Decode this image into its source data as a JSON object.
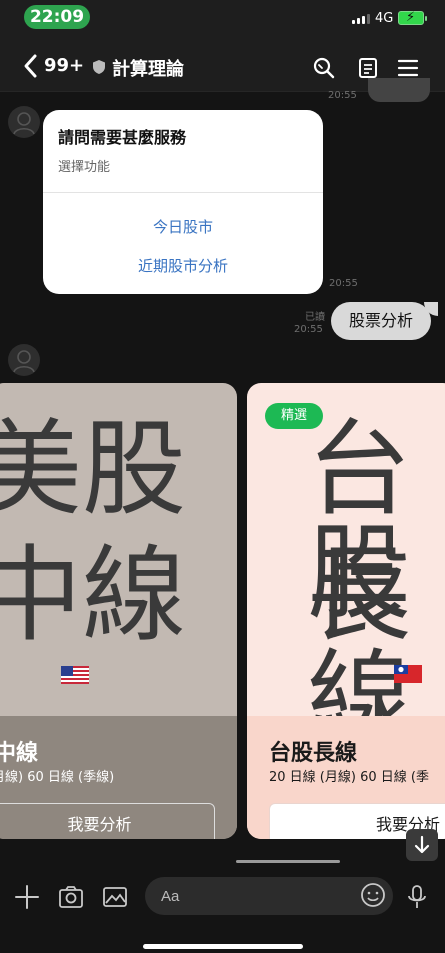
{
  "status_bar": {
    "time": "22:09",
    "network": "4G"
  },
  "header": {
    "unread_count": "99+",
    "title": "計算理論"
  },
  "messages": {
    "prev_time": "20:55",
    "card": {
      "title": "請問需要甚麼服務",
      "subtitle": "選擇功能",
      "options": [
        "今日股市",
        "近期股市分析"
      ],
      "time": "20:55"
    },
    "user_bubble": {
      "text": "股票分析",
      "read": "已讀",
      "time": "20:55"
    }
  },
  "carousel": [
    {
      "big_chars": [
        "美股",
        "中線"
      ],
      "name": "中線",
      "desc": "月線)  60 日線 (季線)",
      "button": "我要分析",
      "flag": "us-flag-icon"
    },
    {
      "badge": "精選",
      "big_chars": [
        "台股",
        "長線"
      ],
      "name": "台股長線",
      "desc": "20 日線 (月線)  60 日線 (季",
      "button": "我要分析",
      "flag": "taiwan-flag-icon"
    }
  ],
  "input": {
    "placeholder": "Aa"
  },
  "colors": {
    "accent_green": "#2ea44f",
    "link_blue": "#3a74c2",
    "badge_green": "#1db954"
  }
}
